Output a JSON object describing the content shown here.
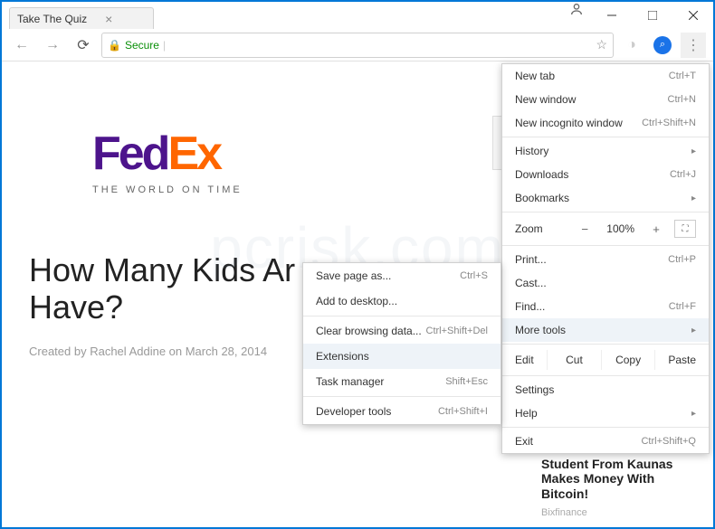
{
  "tab": {
    "title": "Take The Quiz"
  },
  "address": {
    "secure_label": "Secure"
  },
  "page": {
    "logo_fed": "Fed",
    "logo_ex": "Ex",
    "tagline": "THE WORLD ON TIME",
    "headline_l1": "How Many Kids Ar",
    "headline_l2": "Have?",
    "byline": "Created by Rachel Addine on March 28, 2014",
    "card_title": "Student From Kaunas Makes Money With Bitcoin!",
    "card_source": "Bixfinance"
  },
  "menu": {
    "new_tab": "New tab",
    "new_tab_k": "Ctrl+T",
    "new_window": "New window",
    "new_window_k": "Ctrl+N",
    "incognito": "New incognito window",
    "incognito_k": "Ctrl+Shift+N",
    "history": "History",
    "downloads": "Downloads",
    "downloads_k": "Ctrl+J",
    "bookmarks": "Bookmarks",
    "zoom": "Zoom",
    "zoom_pct": "100%",
    "print": "Print...",
    "print_k": "Ctrl+P",
    "cast": "Cast...",
    "find": "Find...",
    "find_k": "Ctrl+F",
    "more_tools": "More tools",
    "edit": "Edit",
    "cut": "Cut",
    "copy": "Copy",
    "paste": "Paste",
    "settings": "Settings",
    "help": "Help",
    "exit": "Exit",
    "exit_k": "Ctrl+Shift+Q"
  },
  "submenu": {
    "save_as": "Save page as...",
    "save_as_k": "Ctrl+S",
    "add_desktop": "Add to desktop...",
    "clear_data": "Clear browsing data...",
    "clear_data_k": "Ctrl+Shift+Del",
    "extensions": "Extensions",
    "task_mgr": "Task manager",
    "task_mgr_k": "Shift+Esc",
    "dev_tools": "Developer tools",
    "dev_tools_k": "Ctrl+Shift+I"
  },
  "watermark": "pcrisk.com"
}
